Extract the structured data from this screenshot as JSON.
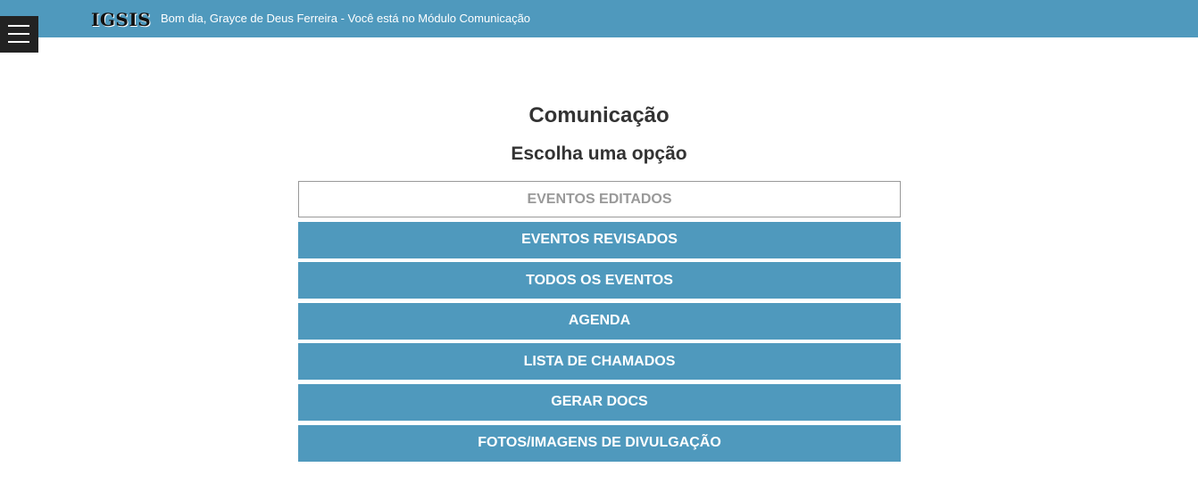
{
  "header": {
    "brand": "IGSIS",
    "greeting": "Bom dia, Grayce de Deus Ferreira - Você está no Módulo Comunicação",
    "menu_icon": "hamburger-menu-icon",
    "bar_color": "#4f99bd"
  },
  "main": {
    "title": "Comunicação",
    "subtitle": "Escolha uma opção",
    "options": [
      {
        "label": "EVENTOS EDITADOS"
      },
      {
        "label": "EVENTOS REVISADOS"
      },
      {
        "label": "TODOS OS EVENTOS"
      },
      {
        "label": "AGENDA"
      },
      {
        "label": "LISTA DE CHAMADOS"
      },
      {
        "label": "GERAR DOCS"
      },
      {
        "label": "FOTOS/IMAGENS DE DIVULGAÇÃO"
      }
    ]
  }
}
